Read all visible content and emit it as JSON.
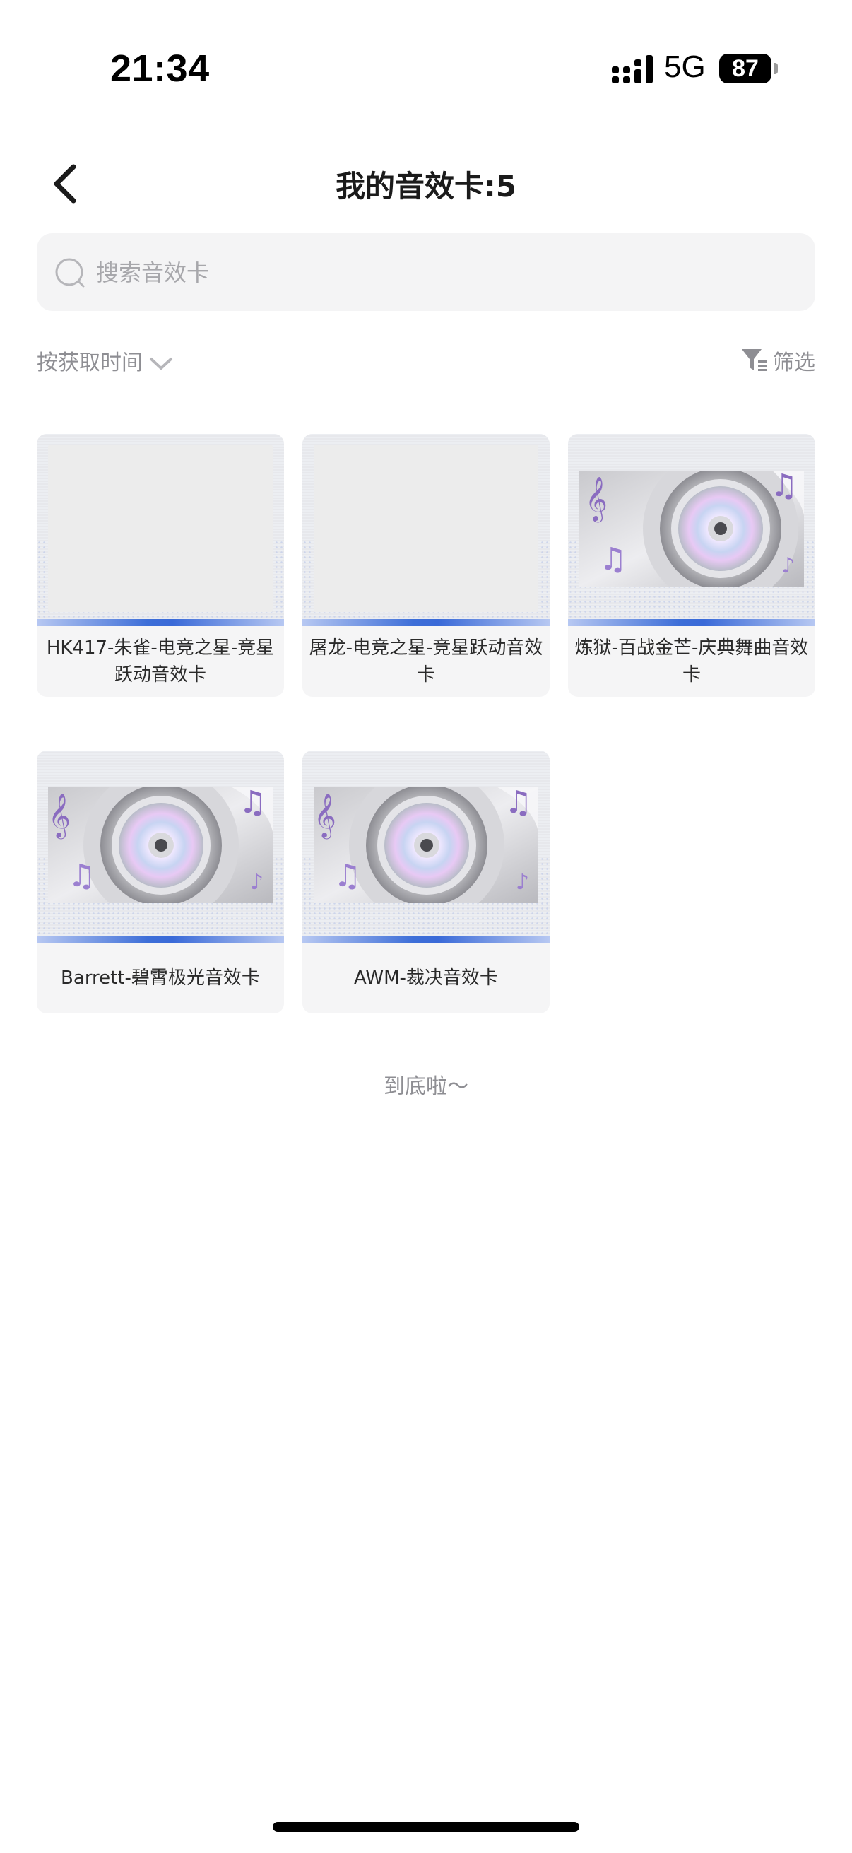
{
  "status_bar": {
    "time": "21:34",
    "network": "5G",
    "battery": "87"
  },
  "header": {
    "title": "我的音效卡:5"
  },
  "search": {
    "placeholder": "搜索音效卡"
  },
  "sort": {
    "label": "按获取时间"
  },
  "filter": {
    "label": "筛选"
  },
  "cards": [
    {
      "label": "HK417-朱雀-电竞之星-竞星跃动音效卡",
      "art": "placeholder"
    },
    {
      "label": "屠龙-电竞之星-竞星跃动音效卡",
      "art": "placeholder"
    },
    {
      "label": "炼狱-百战金芒-庆典舞曲音效卡",
      "art": "cd-music"
    },
    {
      "label": "Barrett-碧霄极光音效卡",
      "art": "cd-music"
    },
    {
      "label": "AWM-裁决音效卡",
      "art": "cd-music"
    }
  ],
  "footer": {
    "end_text": "到底啦～"
  },
  "colors": {
    "accent_blue": "#3d6ed8",
    "muted_text": "#8e8e93",
    "card_bg": "#f5f5f6"
  }
}
